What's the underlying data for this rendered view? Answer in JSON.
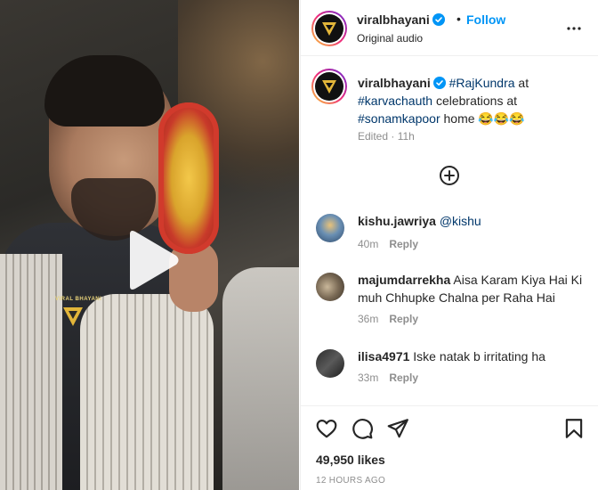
{
  "post": {
    "username": "viralbhayani",
    "follow_label": "Follow",
    "dot": "•",
    "audio": "Original audio",
    "watermark": "VIRAL BHAYANI"
  },
  "caption": {
    "username": "viralbhayani",
    "tag1": "#RajKundra",
    "text1": " at ",
    "tag2": "#karvachauth",
    "text2": " celebrations at ",
    "tag3": "#sonamkapoor",
    "text3": " home 😂😂😂",
    "edited": "Edited · 11h"
  },
  "comments": [
    {
      "username": "kishu.jawriya",
      "text": "@kishu",
      "time": "40m",
      "reply": "Reply"
    },
    {
      "username": "majumdarrekha",
      "text": "Aisa Karam Kiya Hai Ki muh Chhupke Chalna per Raha Hai",
      "time": "36m",
      "reply": "Reply"
    },
    {
      "username": "ilisa4971",
      "text": "Iske natak b irritating ha",
      "time": "33m",
      "reply": "Reply"
    }
  ],
  "footer": {
    "likes": "49,950 likes",
    "time": "12 HOURS AGO"
  },
  "colors": {
    "accent": "#0095f6",
    "link": "#00376b",
    "muted": "#8e8e8e"
  },
  "icons": [
    "play-icon",
    "verified-icon",
    "more-icon",
    "add-circle-icon",
    "heart-icon",
    "comment-icon",
    "share-icon",
    "bookmark-icon"
  ]
}
